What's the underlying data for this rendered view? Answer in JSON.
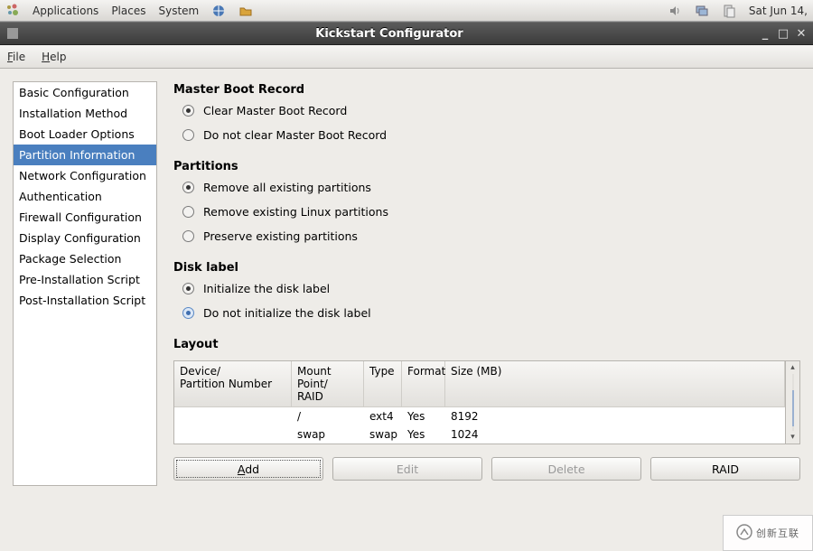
{
  "panel": {
    "applications": "Applications",
    "places": "Places",
    "system": "System",
    "clock": "Sat Jun 14,"
  },
  "window": {
    "title": "Kickstart Configurator"
  },
  "menubar": {
    "file": "File",
    "help": "Help"
  },
  "sidebar": {
    "items": [
      {
        "label": "Basic Configuration"
      },
      {
        "label": "Installation Method"
      },
      {
        "label": "Boot Loader Options"
      },
      {
        "label": "Partition Information",
        "selected": true
      },
      {
        "label": "Network Configuration"
      },
      {
        "label": "Authentication"
      },
      {
        "label": "Firewall Configuration"
      },
      {
        "label": "Display Configuration"
      },
      {
        "label": "Package Selection"
      },
      {
        "label": "Pre-Installation Script"
      },
      {
        "label": "Post-Installation Script"
      }
    ]
  },
  "mbr": {
    "title": "Master Boot Record",
    "clear": "Clear Master Boot Record",
    "noclear": "Do not clear Master Boot Record",
    "selected": "clear"
  },
  "partitions": {
    "title": "Partitions",
    "remove_all": "Remove all existing partitions",
    "remove_linux": "Remove existing Linux partitions",
    "preserve": "Preserve existing partitions",
    "selected": "remove_all"
  },
  "disklabel": {
    "title": "Disk label",
    "init": "Initialize the disk label",
    "noinit": "Do not initialize the disk label",
    "selected": "init"
  },
  "layout": {
    "title": "Layout",
    "headers": {
      "device": "Device/\nPartition Number",
      "mount": "Mount Point/\nRAID",
      "type": "Type",
      "format": "Format",
      "size": "Size (MB)"
    },
    "rows": [
      {
        "device": "",
        "mount": "/",
        "type": "ext4",
        "format": "Yes",
        "size": "8192"
      },
      {
        "device": "",
        "mount": "swap",
        "type": "swap",
        "format": "Yes",
        "size": "1024"
      }
    ]
  },
  "buttons": {
    "add": "Add",
    "edit": "Edit",
    "delete": "Delete",
    "raid": "RAID"
  },
  "watermark": "创新互联"
}
